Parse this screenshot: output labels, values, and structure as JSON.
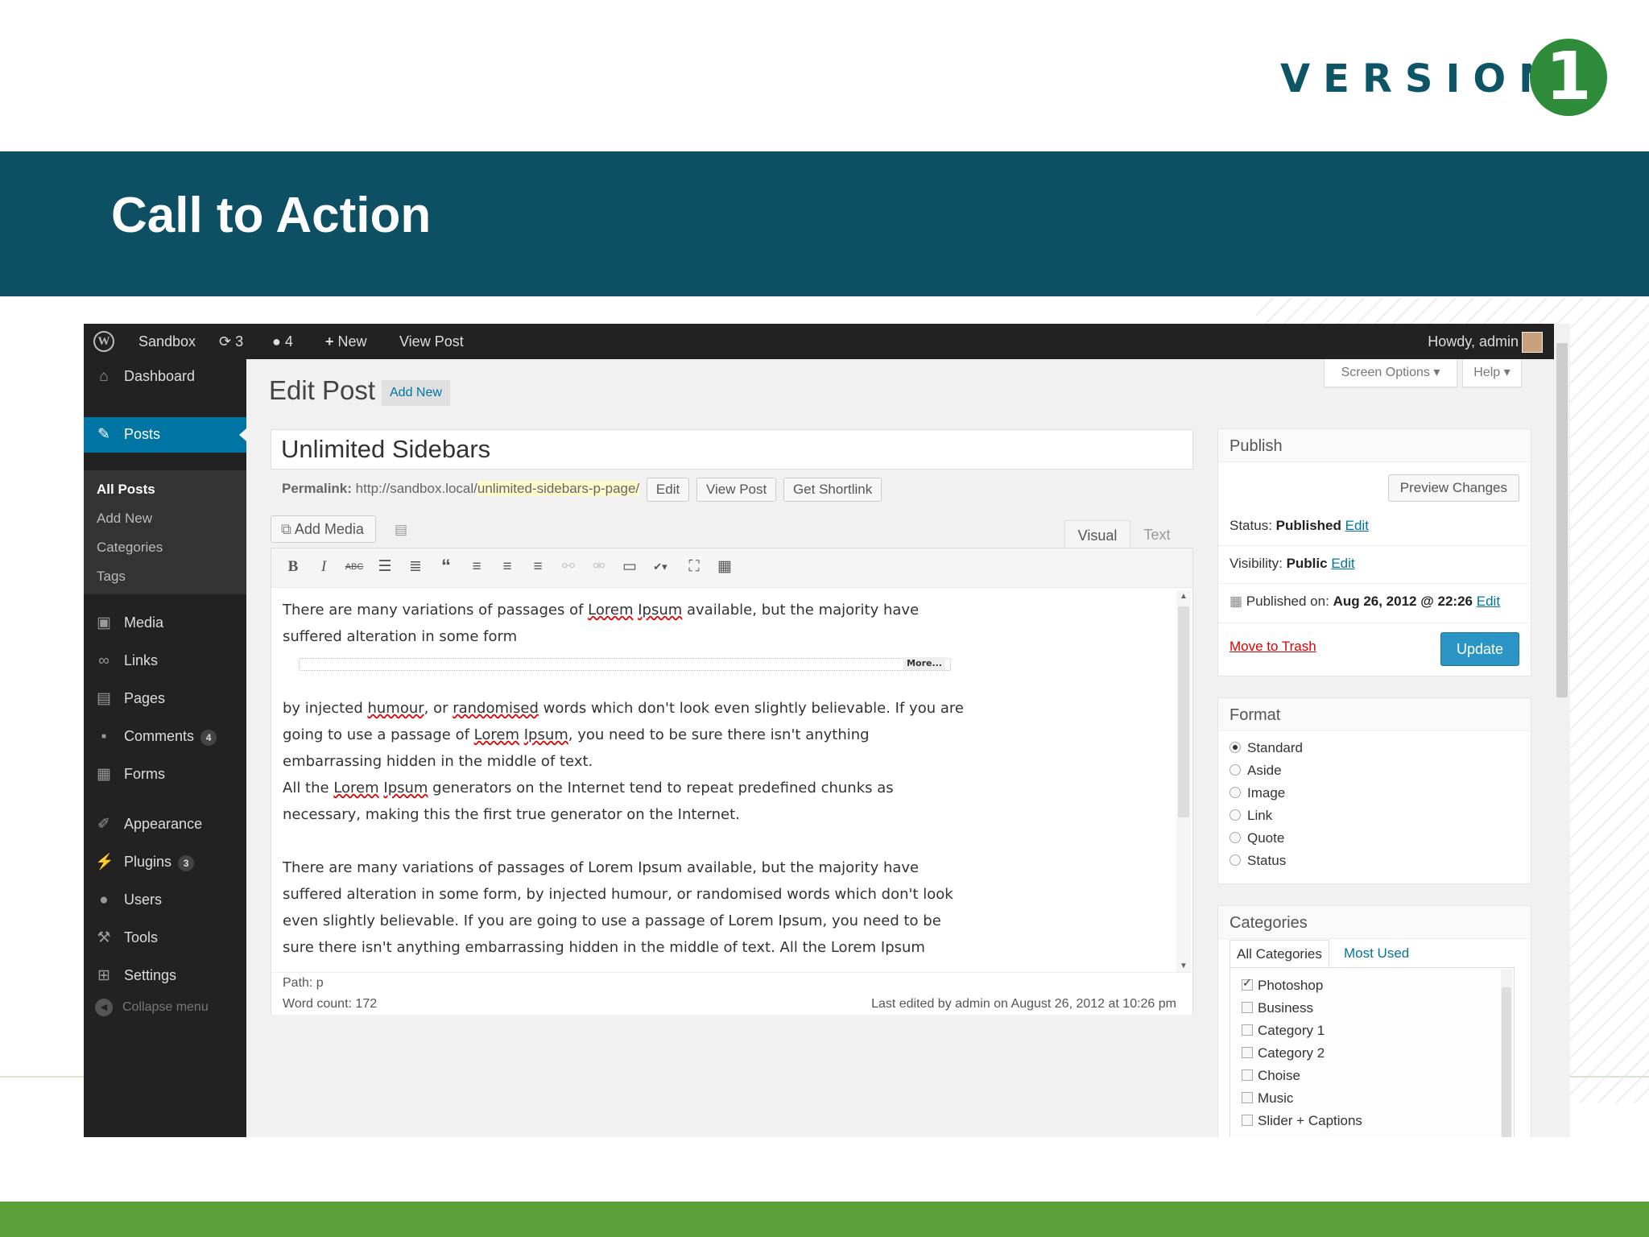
{
  "slide": {
    "logo_text": "VERSION",
    "logo_mark": "1",
    "title": "Call to Action"
  },
  "adminbar": {
    "site": "Sandbox",
    "updates": "3",
    "comments": "4",
    "new": "New",
    "view_post": "View Post",
    "howdy": "Howdy, admin"
  },
  "sidebar": {
    "items": [
      {
        "label": "Dashboard",
        "icon": "home-icon"
      },
      {
        "label": "Posts",
        "icon": "pin-icon"
      },
      {
        "label": "Media",
        "icon": "media-icon"
      },
      {
        "label": "Links",
        "icon": "link-icon"
      },
      {
        "label": "Pages",
        "icon": "page-icon"
      },
      {
        "label": "Comments",
        "icon": "comment-icon",
        "count": "4"
      },
      {
        "label": "Forms",
        "icon": "form-icon"
      },
      {
        "label": "Appearance",
        "icon": "brush-icon"
      },
      {
        "label": "Plugins",
        "icon": "plug-icon",
        "count": "3"
      },
      {
        "label": "Users",
        "icon": "user-icon"
      },
      {
        "label": "Tools",
        "icon": "wrench-icon"
      },
      {
        "label": "Settings",
        "icon": "settings-icon"
      }
    ],
    "submenu": [
      "All Posts",
      "Add New",
      "Categories",
      "Tags"
    ],
    "collapse": "Collapse menu"
  },
  "header": {
    "screen_options": "Screen Options ▾",
    "help": "Help ▾",
    "page_title": "Edit Post",
    "add_new": "Add New"
  },
  "post": {
    "title": "Unlimited Sidebars",
    "permalink_label": "Permalink:",
    "permalink_base": "http://sandbox.local/",
    "permalink_slug": "unlimited-sidebars-p-page/",
    "edit": "Edit",
    "view_post": "View Post",
    "get_shortlink": "Get Shortlink",
    "add_media": "Add Media",
    "tab_visual": "Visual",
    "tab_text": "Text",
    "more_label": "More...",
    "p1": {
      "a": "There are many variations of passages of ",
      "lorem": "Lorem",
      "ipsum": "Ipsum",
      "b": " available, but the majority have suffered alteration in some form"
    },
    "p2": {
      "a": "by injected ",
      "humour": "humour",
      "b": ", or ",
      "randomised": "randomised",
      "c": " words which don't look even slightly believable. If you are going to use a passage of ",
      "lorem": "Lorem",
      "ipsum": "Ipsum",
      "d": ", you need to be sure there isn't anything embarrassing hidden in the middle of text."
    },
    "p3": {
      "a": "All the ",
      "lorem": "Lorem",
      "ipsum": "Ipsum",
      "b": " generators on the Internet tend to repeat predefined chunks as necessary, making this the first true generator on the Internet."
    },
    "p4": "There are many variations of passages of Lorem Ipsum available, but the majority have suffered alteration in some form, by injected humour, or randomised words which don't look even slightly believable. If you are going to use a passage of Lorem Ipsum, you need to be sure there isn't anything embarrassing hidden in the middle of text. All the Lorem Ipsum",
    "path": "Path: p",
    "word_count": "Word count: 172",
    "last_edited": "Last edited by admin on August 26, 2012 at 10:26 pm"
  },
  "publish": {
    "heading": "Publish",
    "preview": "Preview Changes",
    "status_label": "Status:",
    "status_value": "Published",
    "visibility_label": "Visibility:",
    "visibility_value": "Public",
    "published_label": "Published on:",
    "published_value": "Aug 26, 2012 @ 22:26",
    "edit": "Edit",
    "trash": "Move to Trash",
    "update": "Update"
  },
  "format": {
    "heading": "Format",
    "options": [
      "Standard",
      "Aside",
      "Image",
      "Link",
      "Quote",
      "Status"
    ],
    "selected": "Standard"
  },
  "categories": {
    "heading": "Categories",
    "tab_all": "All Categories",
    "tab_used": "Most Used",
    "items": [
      "Photoshop",
      "Business",
      "Category 1",
      "Category 2",
      "Choise",
      "Music",
      "Slider + Captions"
    ],
    "checked": [
      "Photoshop"
    ]
  },
  "colors": {
    "banner": "#0d4f63",
    "wp_blue": "#0074a2",
    "update_button": "#2a95c5",
    "footer_green": "#5aa13a"
  }
}
